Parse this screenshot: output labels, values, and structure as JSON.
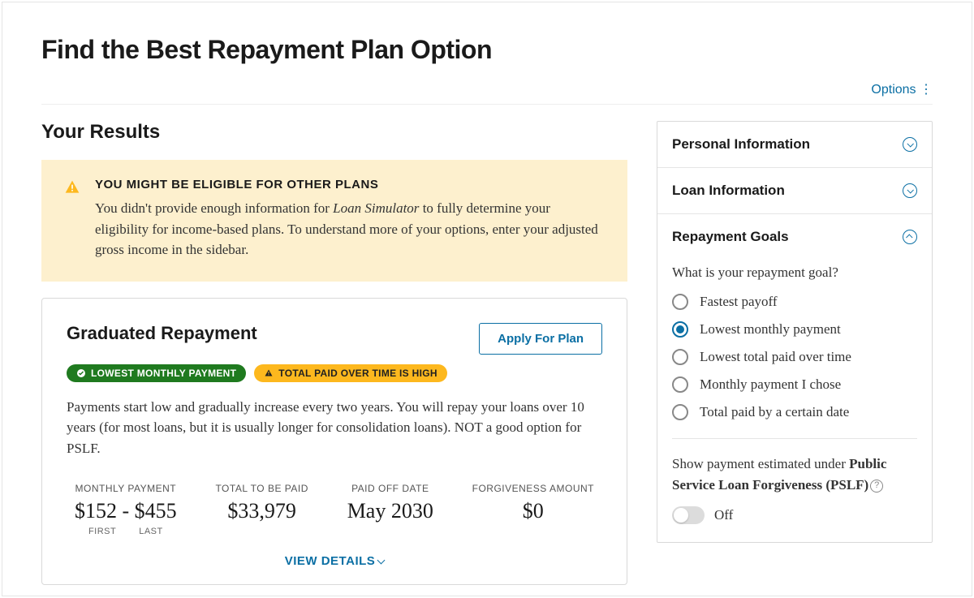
{
  "page_title": "Find the Best Repayment Plan Option",
  "options_label": "Options",
  "results_title": "Your Results",
  "alert": {
    "title": "YOU MIGHT BE ELIGIBLE FOR OTHER PLANS",
    "body_pre": "You didn't provide enough information for ",
    "body_em": "Loan Simulator",
    "body_post": " to fully determine your eligibility for income-based plans. To understand more of your options, enter your adjusted gross income in the sidebar."
  },
  "plan": {
    "name": "Graduated Repayment",
    "apply_label": "Apply For Plan",
    "badge_green": "LOWEST MONTHLY PAYMENT",
    "badge_yellow": "TOTAL PAID OVER TIME IS HIGH",
    "description": "Payments start low and gradually increase every two years. You will repay your loans over 10 years (for most loans, but it is usually longer for consolidation loans). NOT a good option for PSLF.",
    "metrics": {
      "monthly_label": "MONTHLY PAYMENT",
      "monthly_value": "$152 - $455",
      "monthly_first": "FIRST",
      "monthly_last": "LAST",
      "total_label": "TOTAL TO BE PAID",
      "total_value": "$33,979",
      "paidoff_label": "PAID OFF DATE",
      "paidoff_value": "May 2030",
      "forgiveness_label": "FORGIVENESS AMOUNT",
      "forgiveness_value": "$0"
    },
    "view_details": "VIEW DETAILS"
  },
  "sidebar": {
    "sections": {
      "personal": "Personal Information",
      "loan": "Loan Information",
      "goals": "Repayment Goals"
    },
    "goals": {
      "question": "What is your repayment goal?",
      "options": [
        {
          "label": "Fastest payoff",
          "selected": false
        },
        {
          "label": "Lowest monthly payment",
          "selected": true
        },
        {
          "label": "Lowest total paid over time",
          "selected": false
        },
        {
          "label": "Monthly payment I chose",
          "selected": false
        },
        {
          "label": "Total paid by a certain date",
          "selected": false
        }
      ],
      "pslf_pre": "Show payment estimated under ",
      "pslf_bold": "Public Service Loan Forgiveness (PSLF)",
      "toggle_state": "Off"
    }
  }
}
